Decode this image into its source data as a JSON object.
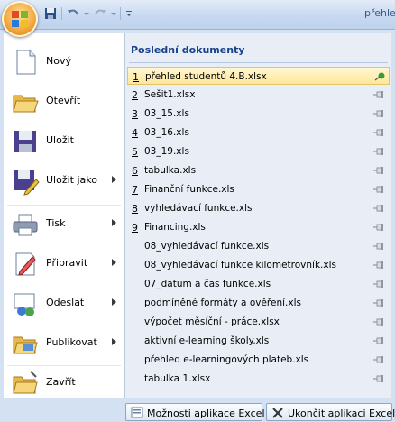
{
  "window": {
    "title": "přehle"
  },
  "commands": [
    {
      "label": "Nový",
      "submenu": false
    },
    {
      "label": "Otevřít",
      "submenu": false
    },
    {
      "label": "Uložit",
      "submenu": false
    },
    {
      "label": "Uložit jako",
      "submenu": true
    },
    {
      "label": "Tisk",
      "submenu": true
    },
    {
      "label": "Připravit",
      "submenu": true
    },
    {
      "label": "Odeslat",
      "submenu": true
    },
    {
      "label": "Publikovat",
      "submenu": true
    },
    {
      "label": "Zavřít",
      "submenu": false
    }
  ],
  "recent": {
    "title": "Poslední dokumenty",
    "items": [
      {
        "num": "1",
        "name": "přehled studentů 4.B.xlsx",
        "pinned": true
      },
      {
        "num": "2",
        "name": "Sešit1.xlsx",
        "pinned": false
      },
      {
        "num": "3",
        "name": "03_15.xls",
        "pinned": false
      },
      {
        "num": "4",
        "name": "03_16.xls",
        "pinned": false
      },
      {
        "num": "5",
        "name": "03_19.xls",
        "pinned": false
      },
      {
        "num": "6",
        "name": "tabulka.xls",
        "pinned": false
      },
      {
        "num": "7",
        "name": "Finanční funkce.xls",
        "pinned": false
      },
      {
        "num": "8",
        "name": "vyhledávací funkce.xls",
        "pinned": false
      },
      {
        "num": "9",
        "name": "Financing.xls",
        "pinned": false
      },
      {
        "num": "",
        "name": "08_vyhledávací funkce.xls",
        "pinned": false
      },
      {
        "num": "",
        "name": "08_vyhledávací funkce kilometrovník.xls",
        "pinned": false
      },
      {
        "num": "",
        "name": "07_datum a čas funkce.xls",
        "pinned": false
      },
      {
        "num": "",
        "name": "podmíněné formáty a ověření.xls",
        "pinned": false
      },
      {
        "num": "",
        "name": "výpočet měsíční - práce.xlsx",
        "pinned": false
      },
      {
        "num": "",
        "name": "aktivní e-learning školy.xls",
        "pinned": false
      },
      {
        "num": "",
        "name": "přehled e-learningových plateb.xls",
        "pinned": false
      },
      {
        "num": "",
        "name": "tabulka 1.xlsx",
        "pinned": false
      }
    ]
  },
  "bottom": {
    "options_label": "Možnosti aplikace Excel",
    "exit_label": "Ukončit aplikaci Excel"
  },
  "colors": {
    "accent": "#15428b",
    "selection": "#ffe79a",
    "pin_active": "#3a9a3a"
  },
  "icons": [
    "new-document-icon",
    "open-folder-icon",
    "save-disk-icon",
    "save-as-icon",
    "print-icon",
    "prepare-icon",
    "send-icon",
    "publish-icon",
    "close-icon",
    "pin-icon",
    "options-icon",
    "exit-icon"
  ]
}
